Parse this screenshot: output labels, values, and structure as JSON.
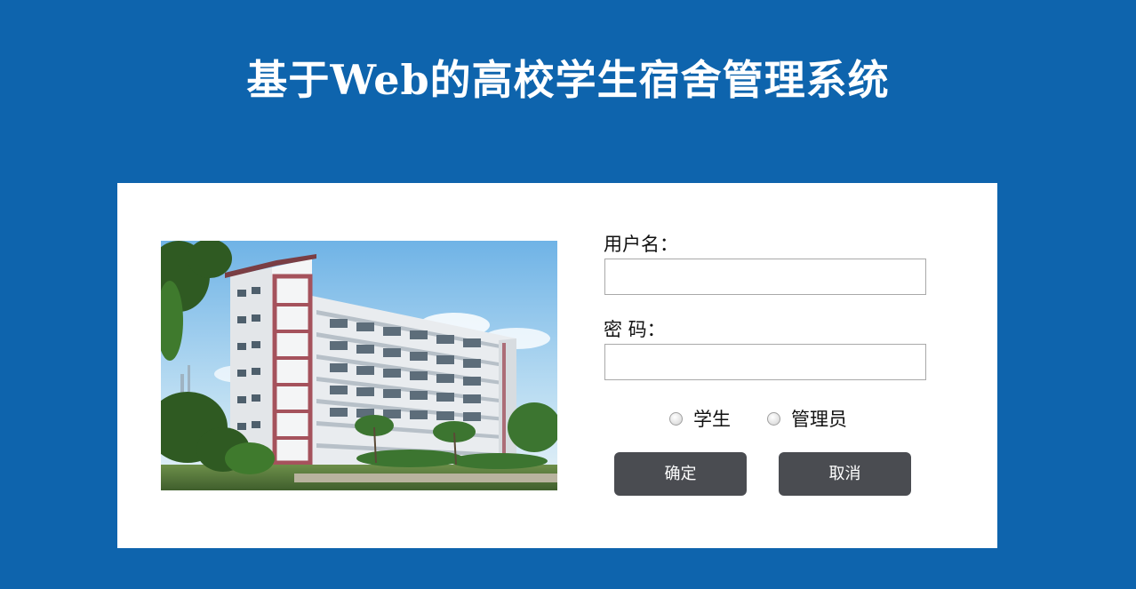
{
  "header": {
    "title": "基于Web的高校学生宿舍管理系统"
  },
  "login": {
    "username_label": "用户名：",
    "username_value": "",
    "password_label": "密 码：",
    "password_value": "",
    "roles": [
      {
        "label": "学生",
        "selected": false
      },
      {
        "label": "管理员",
        "selected": false
      }
    ],
    "confirm_label": "确定",
    "cancel_label": "取消"
  },
  "image": {
    "subject": "dormitory-building-photo"
  },
  "colors": {
    "background": "#0e64ad",
    "panel": "#ffffff",
    "button": "#4a4c51",
    "button_text": "#ffffff"
  }
}
